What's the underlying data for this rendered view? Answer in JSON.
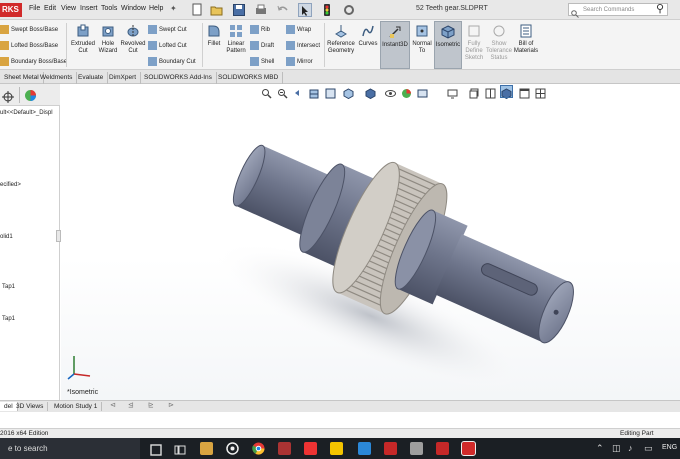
{
  "app": {
    "logo_text": "RKS",
    "document_title": "52 Teeth gear.SLDPRT"
  },
  "menu": [
    "File",
    "Edit",
    "View",
    "Insert",
    "Tools",
    "Window",
    "Help"
  ],
  "search": {
    "placeholder": "Search Commands"
  },
  "ribbon": {
    "boss_group": [
      "Swept Boss/Base",
      "Lofted Boss/Base",
      "Boundary Boss/Base"
    ],
    "extruded_cut": "Extruded Cut",
    "hole_wizard": "Hole Wizard",
    "revolved_cut": "Revolved Cut",
    "cut_group": [
      "Swept Cut",
      "Lofted Cut",
      "Boundary Cut"
    ],
    "fillet": "Fillet",
    "linear_pattern": "Linear Pattern",
    "feature_group": [
      "Rib",
      "Draft",
      "Shell"
    ],
    "feature_group2": [
      "Wrap",
      "Intersect",
      "Mirror"
    ],
    "reference_geometry": "Reference Geometry",
    "curves": "Curves",
    "instant3d": "Instant3D",
    "normal_to": "Normal To",
    "isometric": "Isometric",
    "fully_define_sketch": "Fully Define Sketch",
    "show_tolerance_status": "Show Tolerance Status",
    "bill_of_materials": "Bill of Materials"
  },
  "tabs": [
    "Sheet Metal",
    "Weldments",
    "Evaluate",
    "DimXpert",
    "SOLIDWORKS Add-Ins",
    "SOLIDWORKS MBD"
  ],
  "tree": {
    "config": "ult<<Default>_Displ",
    "unspecified": "ecified>",
    "solid": "olid1",
    "tap1": "Tap1",
    "tap2": "Tap1"
  },
  "viewport": {
    "view_label": "*Isometric"
  },
  "bottom_tabs": [
    "del",
    "3D Views",
    "Motion Study 1"
  ],
  "status": {
    "edition": "2016 x64 Edition",
    "mode": "Editing Part"
  },
  "taskbar": {
    "search_text": "e to search",
    "lang": "ENG"
  },
  "colors": {
    "part": "#7a8299",
    "gear": "#c9c4bd",
    "accent_red": "#d12a2a",
    "taskbar": "#1b1f24"
  }
}
